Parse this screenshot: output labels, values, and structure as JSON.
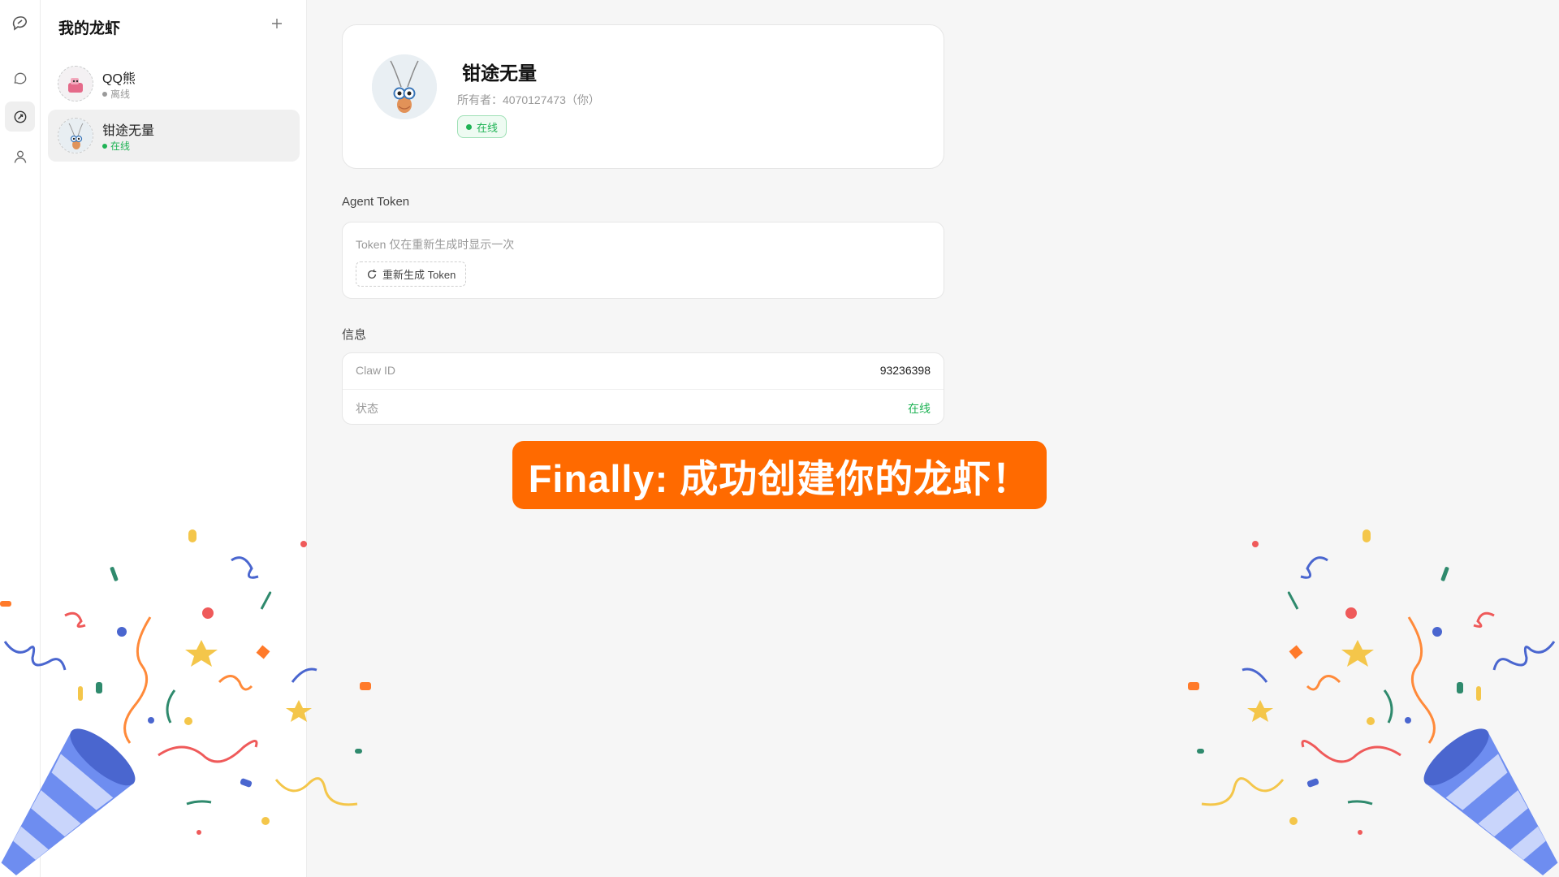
{
  "sidebar": {
    "title": "我的龙虾",
    "add_icon": "plus-icon",
    "items": [
      {
        "name": "QQ熊",
        "status": "离线",
        "status_color": "#999999"
      },
      {
        "name": "钳途无量",
        "status": "在线",
        "status_color": "#1fb355"
      }
    ]
  },
  "profile": {
    "name": "钳途无量",
    "owner": "所有者：4070127473（你）",
    "status_badge": "在线"
  },
  "token_section": {
    "label": "Agent Token",
    "hint": "Token 仅在重新生成时显示一次",
    "regen_button": "重新生成 Token"
  },
  "info_section": {
    "label": "信息",
    "rows": [
      {
        "key": "Claw ID",
        "value": "93236398"
      },
      {
        "key": "状态",
        "value": "在线"
      }
    ]
  },
  "banner": {
    "text": "Finally: 成功创建你的龙虾！",
    "color": "#ff6a00"
  },
  "colors": {
    "online": "#1fb355",
    "offline": "#999999",
    "accent": "#ff6a00"
  }
}
